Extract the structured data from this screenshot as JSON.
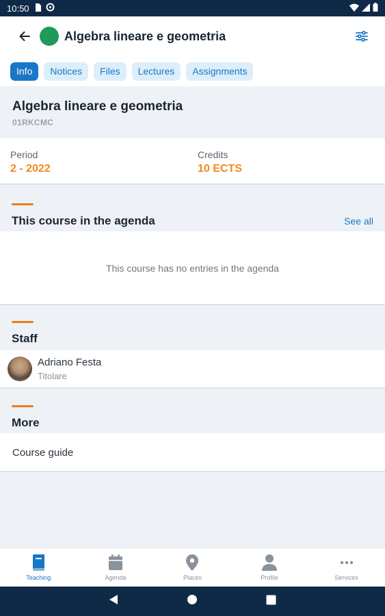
{
  "status_bar": {
    "time": "10:50"
  },
  "header": {
    "title": "Algebra lineare e geometria",
    "course_color": "#1e9a5a",
    "tabs": [
      {
        "label": "Info",
        "active": true
      },
      {
        "label": "Notices",
        "active": false
      },
      {
        "label": "Files",
        "active": false
      },
      {
        "label": "Lectures",
        "active": false
      },
      {
        "label": "Assignments",
        "active": false
      }
    ]
  },
  "course": {
    "name": "Algebra lineare e geometria",
    "code": "01RKCMC",
    "period_label": "Period",
    "period_value": "2 - 2022",
    "credits_label": "Credits",
    "credits_value": "10 ECTS"
  },
  "agenda": {
    "title": "This course in the agenda",
    "see_all": "See all",
    "empty_message": "This course has no entries in the agenda"
  },
  "staff": {
    "title": "Staff",
    "members": [
      {
        "name": "Adriano Festa",
        "role": "Titolare"
      }
    ]
  },
  "more": {
    "title": "More",
    "items": [
      {
        "label": "Course guide"
      }
    ]
  },
  "bottom_nav": {
    "items": [
      {
        "label": "Teaching",
        "icon": "book-icon",
        "active": true
      },
      {
        "label": "Agenda",
        "icon": "calendar-icon",
        "active": false
      },
      {
        "label": "Places",
        "icon": "map-pin-icon",
        "active": false
      },
      {
        "label": "Profile",
        "icon": "person-icon",
        "active": false
      },
      {
        "label": "Services",
        "icon": "more-dots-icon",
        "active": false
      }
    ]
  },
  "colors": {
    "accent": "#1877c6",
    "highlight": "#f08a1c",
    "system_bar": "#0e2a47"
  }
}
